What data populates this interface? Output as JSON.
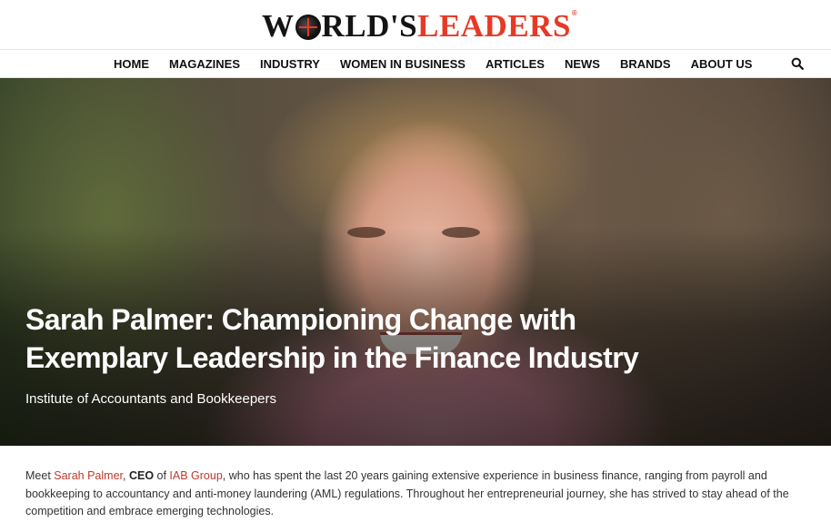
{
  "logo": {
    "part1": "W",
    "part2": "RLD'S",
    "part3": "LEADERS",
    "reg": "®"
  },
  "nav": {
    "items": [
      "HOME",
      "MAGAZINES",
      "INDUSTRY",
      "WOMEN IN BUSINESS",
      "ARTICLES",
      "NEWS",
      "BRANDS",
      "ABOUT US"
    ],
    "search_icon": "search-icon"
  },
  "hero": {
    "title": "Sarah Palmer: Championing Change with Exemplary Leadership in the Finance Industry",
    "subtitle": "Institute of Accountants and Bookkeepers"
  },
  "article": {
    "intro_prefix": "Meet ",
    "person": "Sarah Palmer",
    "comma": ", ",
    "role": "CEO",
    "of_text": " of ",
    "company": "IAB Group",
    "body": ", who has spent the last 20 years gaining extensive experience in business finance, ranging from payroll and bookkeeping to accountancy and anti-money laundering (AML) regulations. Throughout her entrepreneurial journey, she has strived to stay ahead of the competition and embrace emerging technologies."
  },
  "colors": {
    "brand_red": "#e63a26",
    "link_red": "#c0392b",
    "text_dark": "#111111"
  }
}
